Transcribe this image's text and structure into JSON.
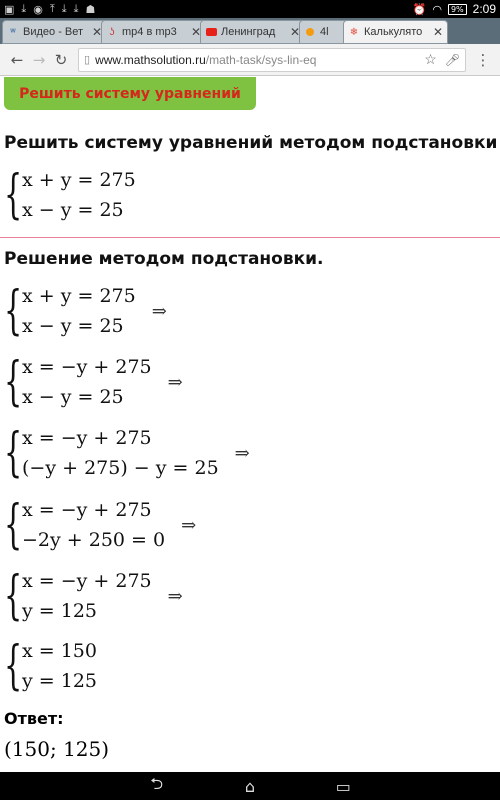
{
  "status_bar": {
    "left_icons": [
      "image-icon",
      "download-icon",
      "camera-icon",
      "upload-icon",
      "download-icon",
      "download-icon",
      "android-icon"
    ],
    "battery": "9%",
    "time": "2:09"
  },
  "tabs": [
    {
      "label": "Видео - Вет",
      "favicon": "vk-icon",
      "active": false
    },
    {
      "label": "mp4 в mp3",
      "favicon": "page-icon",
      "active": false
    },
    {
      "label": "Ленинград",
      "favicon": "youtube-icon",
      "active": false
    },
    {
      "label": "4l",
      "favicon": "orange-dot-icon",
      "active": false
    },
    {
      "label": "Калькулято",
      "favicon": "snowflake-icon",
      "active": true
    }
  ],
  "toolbar": {
    "url_host": "www.mathsolution.ru",
    "url_path": "/math-task/sys-lin-eq"
  },
  "page": {
    "solve_button": "Решить систему уравнений",
    "title": "Решить систему уравнений методом подстановки",
    "initial_system": [
      "x + y = 275",
      "x − y = 25"
    ],
    "solution_heading": "Решение методом подстановки.",
    "steps": [
      {
        "lines": [
          "x + y = 275",
          "x − y = 25"
        ],
        "arrow": "⇒"
      },
      {
        "lines": [
          "x = −y + 275",
          "x − y = 25"
        ],
        "arrow": "⇒"
      },
      {
        "lines": [
          "x = −y + 275",
          "(−y + 275) − y = 25"
        ],
        "arrow": "⇒"
      },
      {
        "lines": [
          "x = −y + 275",
          "−2y + 250 = 0"
        ],
        "arrow": "⇒"
      },
      {
        "lines": [
          "x = −y + 275",
          "y = 125"
        ],
        "arrow": "⇒"
      },
      {
        "lines": [
          "x = 150",
          "y = 125"
        ],
        "arrow": ""
      }
    ],
    "answer_label": "Ответ:",
    "answer_value": "(150; 125)"
  }
}
